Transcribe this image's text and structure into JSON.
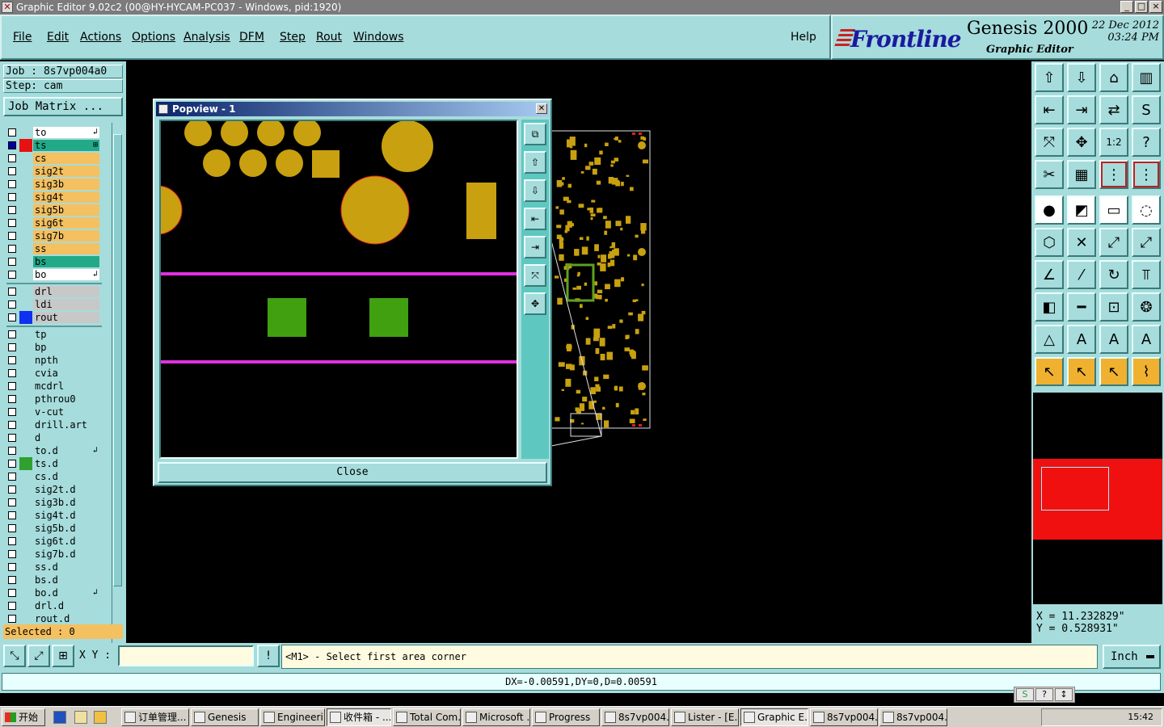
{
  "window": {
    "title": "Graphic Editor 9.02c2 (00@HY-HYCAM-PC037 - Windows, pid:1920)",
    "app_icon": "x-window-icon",
    "controls": [
      "_",
      "□",
      "×"
    ]
  },
  "menu": [
    "File",
    "Edit",
    "Actions",
    "Options",
    "Analysis",
    "DFM",
    "Step",
    "Rout",
    "Windows"
  ],
  "help_label": "Help",
  "brand": {
    "logo_text": "Frontline",
    "product": "Genesis 2000",
    "subtitle": "Graphic Editor",
    "date": "22  Dec 2012",
    "time": "03:24 PM",
    "accent_color": "#1a1aa0",
    "stripe_color": "#d02020"
  },
  "job": {
    "job_label": "Job : 8s7vp004a0",
    "step_label": "Step: cam",
    "matrix_button": "Job Matrix ..."
  },
  "layers_group1": [
    {
      "name": "to",
      "bg": "#ffffff",
      "color": "",
      "mark": "↲"
    },
    {
      "name": "ts",
      "bg": "#22aa88",
      "color": "#e81010",
      "mark": "⊞"
    },
    {
      "name": "cs",
      "bg": "#f4c060",
      "color": "",
      "mark": ""
    },
    {
      "name": "sig2t",
      "bg": "#f4c060",
      "color": "",
      "mark": ""
    },
    {
      "name": "sig3b",
      "bg": "#f4c060",
      "color": "",
      "mark": ""
    },
    {
      "name": "sig4t",
      "bg": "#f4c060",
      "color": "",
      "mark": ""
    },
    {
      "name": "sig5b",
      "bg": "#f4c060",
      "color": "",
      "mark": ""
    },
    {
      "name": "sig6t",
      "bg": "#f4c060",
      "color": "",
      "mark": ""
    },
    {
      "name": "sig7b",
      "bg": "#f4c060",
      "color": "",
      "mark": ""
    },
    {
      "name": "ss",
      "bg": "#f4c060",
      "color": "",
      "mark": ""
    },
    {
      "name": "bs",
      "bg": "#22aa88",
      "color": "",
      "mark": ""
    },
    {
      "name": "bo",
      "bg": "#ffffff",
      "color": "",
      "mark": "↲"
    }
  ],
  "layers_group2": [
    {
      "name": "drl",
      "bg": "#c8c8c8",
      "color": "",
      "mark": ""
    },
    {
      "name": "ldi",
      "bg": "#c8c8c8",
      "color": "",
      "mark": ""
    },
    {
      "name": "rout",
      "bg": "#c8c8c8",
      "color": "#1030f0",
      "mark": ""
    }
  ],
  "layers_group3": [
    {
      "name": "tp",
      "bg": "#a6dcdc",
      "color": "",
      "mark": ""
    },
    {
      "name": "bp",
      "bg": "#a6dcdc",
      "color": "",
      "mark": ""
    },
    {
      "name": "npth",
      "bg": "#a6dcdc",
      "color": "",
      "mark": ""
    },
    {
      "name": "cvia",
      "bg": "#a6dcdc",
      "color": "",
      "mark": ""
    },
    {
      "name": "mcdrl",
      "bg": "#a6dcdc",
      "color": "",
      "mark": ""
    },
    {
      "name": "pthrou0",
      "bg": "#a6dcdc",
      "color": "",
      "mark": ""
    },
    {
      "name": "v-cut",
      "bg": "#a6dcdc",
      "color": "",
      "mark": ""
    },
    {
      "name": "drill.art",
      "bg": "#a6dcdc",
      "color": "",
      "mark": ""
    },
    {
      "name": "d",
      "bg": "#a6dcdc",
      "color": "",
      "mark": ""
    },
    {
      "name": "to.d",
      "bg": "#a6dcdc",
      "color": "",
      "mark": "↲"
    },
    {
      "name": "ts.d",
      "bg": "#a6dcdc",
      "color": "#30a030",
      "mark": ""
    },
    {
      "name": "cs.d",
      "bg": "#a6dcdc",
      "color": "",
      "mark": ""
    },
    {
      "name": "sig2t.d",
      "bg": "#a6dcdc",
      "color": "",
      "mark": ""
    },
    {
      "name": "sig3b.d",
      "bg": "#a6dcdc",
      "color": "",
      "mark": ""
    },
    {
      "name": "sig4t.d",
      "bg": "#a6dcdc",
      "color": "",
      "mark": ""
    },
    {
      "name": "sig5b.d",
      "bg": "#a6dcdc",
      "color": "",
      "mark": ""
    },
    {
      "name": "sig6t.d",
      "bg": "#a6dcdc",
      "color": "",
      "mark": ""
    },
    {
      "name": "sig7b.d",
      "bg": "#a6dcdc",
      "color": "",
      "mark": ""
    },
    {
      "name": "ss.d",
      "bg": "#a6dcdc",
      "color": "",
      "mark": ""
    },
    {
      "name": "bs.d",
      "bg": "#a6dcdc",
      "color": "",
      "mark": ""
    },
    {
      "name": "bo.d",
      "bg": "#a6dcdc",
      "color": "",
      "mark": "↲"
    },
    {
      "name": "drl.d",
      "bg": "#a6dcdc",
      "color": "",
      "mark": ""
    },
    {
      "name": "rout.d",
      "bg": "#a6dcdc",
      "color": "",
      "mark": ""
    }
  ],
  "selected_label": "Selected : 0",
  "toolbar_icons": [
    "home-up-icon",
    "home-down-icon",
    "house-icon",
    "split-view-icon",
    "move-left-icon",
    "move-right-icon",
    "swap-icon",
    "s-shape-icon",
    "zoom-fit-icon",
    "zoom-center-icon",
    "scale-1-2-icon",
    "help-icon",
    "pliers-icon",
    "grid-icon",
    "snap-red-icon",
    "snap-red2-icon",
    "pad-select-icon",
    "line-red-icon",
    "ruler-icon",
    "dotted-circle-icon",
    "nodes-icon",
    "cross-pad-icon",
    "diag-nodes-icon",
    "diag-nodes2-icon",
    "angle-icon",
    "slash-icon",
    "arc-icon",
    "double-t-icon",
    "square-dot-icon",
    "red-line-icon",
    "box-dim-icon",
    "cluster-icon",
    "delta-icon",
    "a-red-icon",
    "a-arc-icon",
    "a-strike-icon",
    "arrow-cursor-icon",
    "arrow-box-icon",
    "arrow-hex-icon",
    "route-icon"
  ],
  "coords": {
    "x": "X  =  11.232829\"",
    "y": "Y  =  0.528931\""
  },
  "command": {
    "xy_label": "X Y :",
    "xy_value": "",
    "prompt_text": "<M1> - Select first area corner",
    "units": "Inch"
  },
  "measure_text": "DX=-0.00591,DY=0,D=0.00591",
  "popview": {
    "title": "Popview - 1",
    "close_label": "Close",
    "pad_color": "#c8a010",
    "trace_color": "#e030e0",
    "green_pad_color": "#40a010",
    "tool_icons": [
      "copy-view-icon",
      "pan-up-icon",
      "pan-down-icon",
      "pan-left-icon",
      "pan-right-icon",
      "zoom-out-icon",
      "zoom-in-icon"
    ]
  },
  "taskbar": {
    "start_label": "开始",
    "tasks": [
      {
        "label": "订单管理...",
        "active": false
      },
      {
        "label": "Genesis",
        "active": false
      },
      {
        "label": "Engineeri...",
        "active": false
      },
      {
        "label": "收件箱 - ...",
        "active": true
      },
      {
        "label": "Total Com...",
        "active": false
      },
      {
        "label": "Microsoft ...",
        "active": false
      },
      {
        "label": "Progress",
        "active": false
      },
      {
        "label": "8s7vp004...",
        "active": false
      },
      {
        "label": "Lister - [E...",
        "active": false
      },
      {
        "label": "Graphic E...",
        "active": true
      },
      {
        "label": "8s7vp004...",
        "active": false
      },
      {
        "label": "8s7vp004...",
        "active": false
      }
    ],
    "clock": "15:42"
  },
  "tray_icons": [
    "S",
    "?",
    "↕"
  ]
}
